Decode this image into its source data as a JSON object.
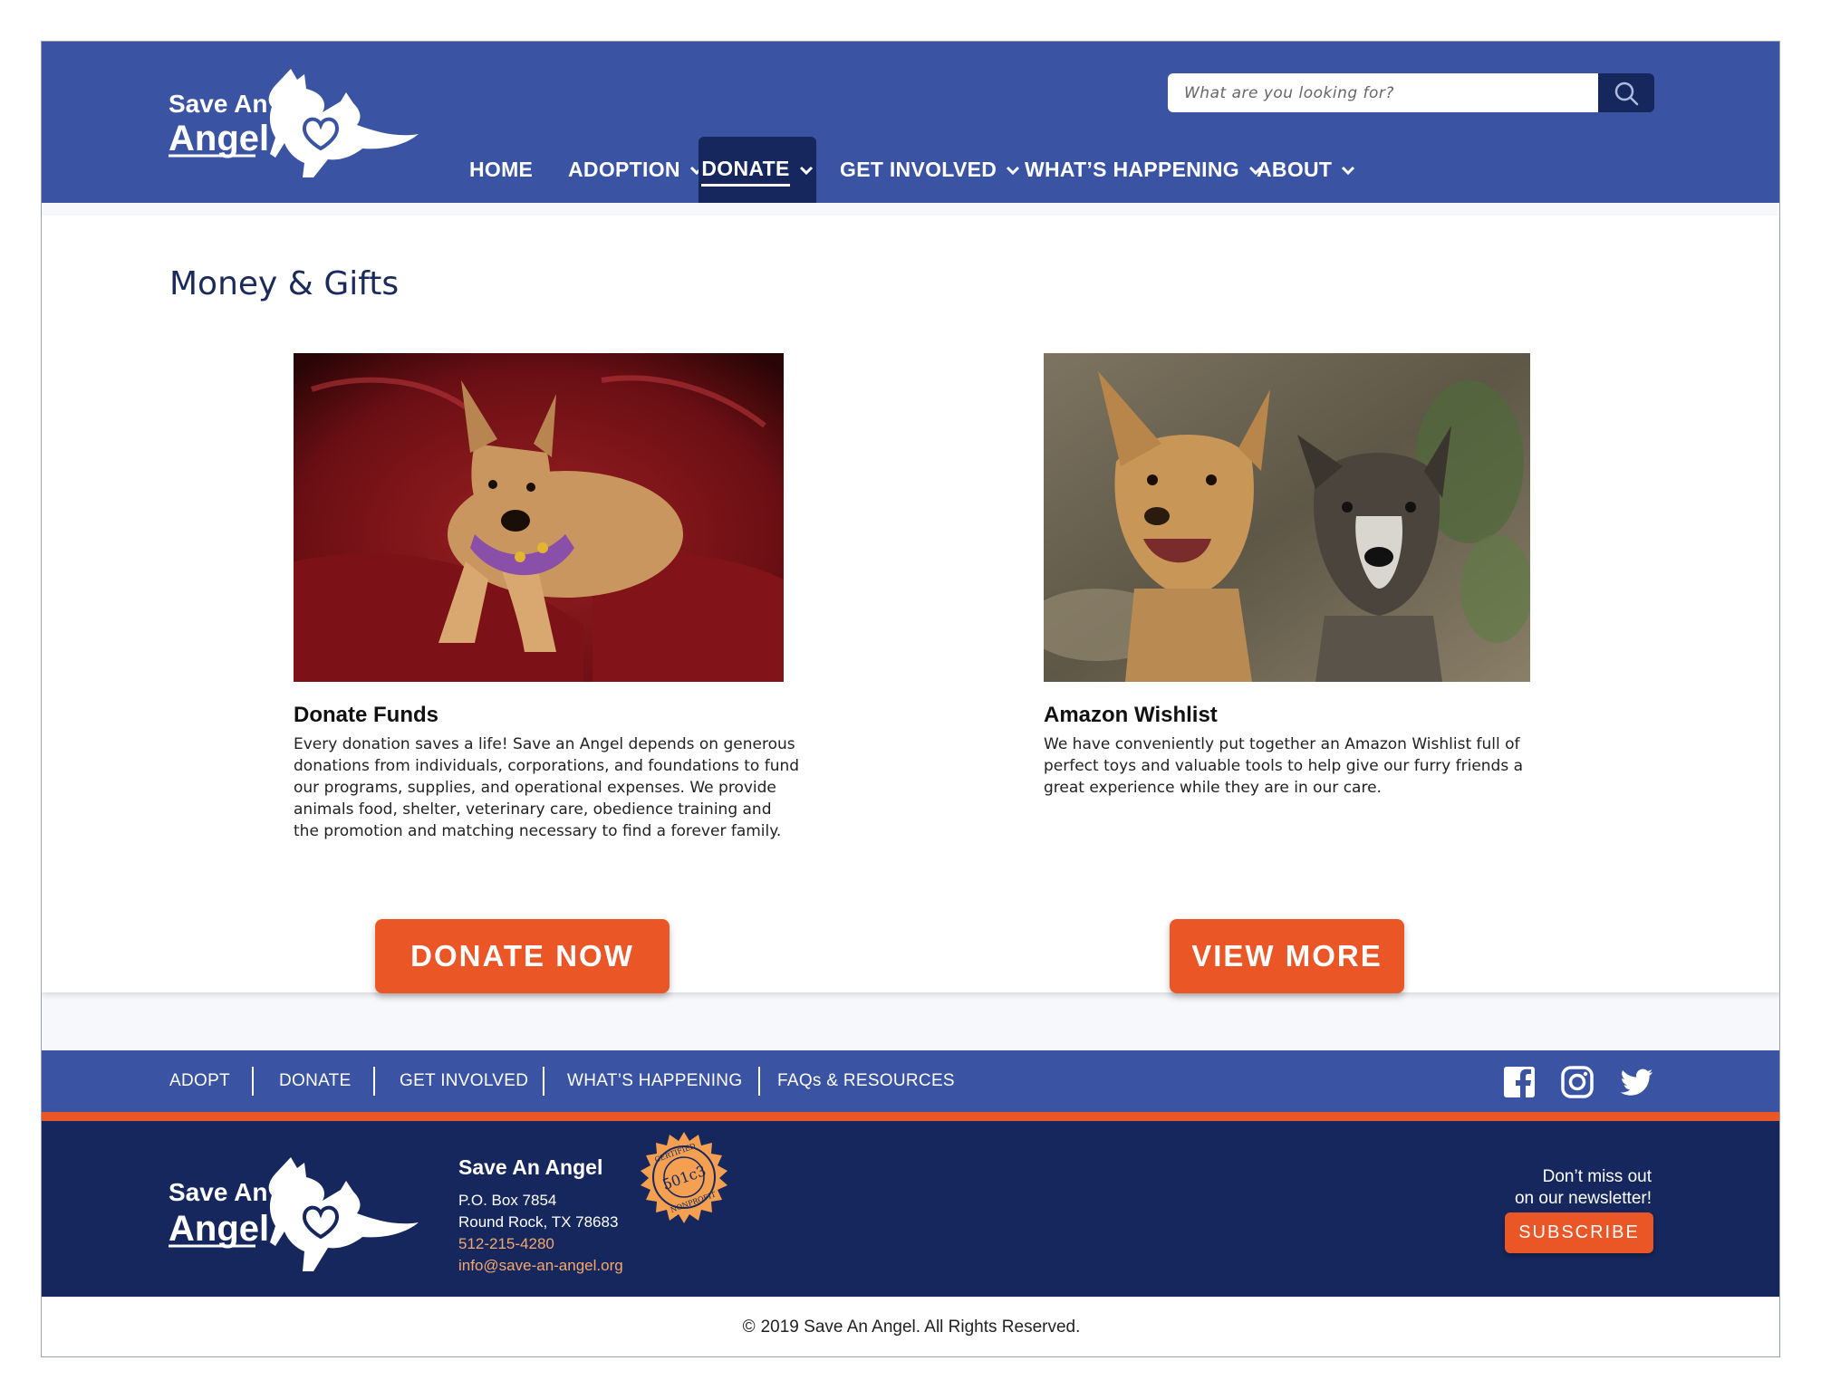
{
  "header": {
    "logo_text_line1": "Save An",
    "logo_text_line2": "Angel",
    "search": {
      "placeholder": "What are you looking for?",
      "icon": "search-icon"
    },
    "nav": [
      {
        "label": "HOME",
        "has_dropdown": false
      },
      {
        "label": "ADOPTION",
        "has_dropdown": true
      },
      {
        "label": "DONATE",
        "has_dropdown": true,
        "active": true
      },
      {
        "label": "GET INVOLVED",
        "has_dropdown": true
      },
      {
        "label": "WHAT’S HAPPENING",
        "has_dropdown": true
      },
      {
        "label": "ABOUT",
        "has_dropdown": true
      }
    ]
  },
  "main": {
    "title": "Money & Gifts",
    "cards": [
      {
        "title": "Donate Funds",
        "text": "Every donation saves a life! Save an Angel depends on generous donations from individuals, corporations, and foundations to fund our programs, supplies, and operational expenses. We provide animals food, shelter, veterinary care, obedience training and the promotion and matching necessary to find a forever family.",
        "button": "DONATE NOW"
      },
      {
        "title": "Amazon Wishlist",
        "text": "We have conveniently put together an Amazon Wishlist full of perfect toys and valuable tools to help give our furry friends a great experience while they are in our care.",
        "button": "VIEW MORE"
      }
    ]
  },
  "footer_nav": {
    "links": [
      "ADOPT",
      "DONATE",
      "GET INVOLVED",
      "WHAT’S HAPPENING",
      "FAQs & RESOURCES"
    ],
    "social": [
      "facebook-icon",
      "instagram-icon",
      "twitter-icon"
    ]
  },
  "footer": {
    "org_name": "Save An Angel",
    "address_line1": "P.O. Box 7854",
    "address_line2": "Round Rock, TX 78683",
    "phone": "512-215-4280",
    "email": "info@save-an-angel.org",
    "seal": {
      "top_text": "CERTIFIED",
      "center_text": "501c3",
      "bottom_text": "NONPROFIT"
    },
    "newsletter_line1": "Don’t miss out",
    "newsletter_line2": "on our newsletter!",
    "subscribe": "SUBSCRIBE"
  },
  "copyright": {
    "symbol": "©",
    "text": "2019 Save An Angel. All Rights Reserved."
  },
  "colors": {
    "primary_blue": "#3a54a3",
    "navy": "#15275d",
    "orange": "#ea5626",
    "link_orange": "#f5a86c"
  }
}
